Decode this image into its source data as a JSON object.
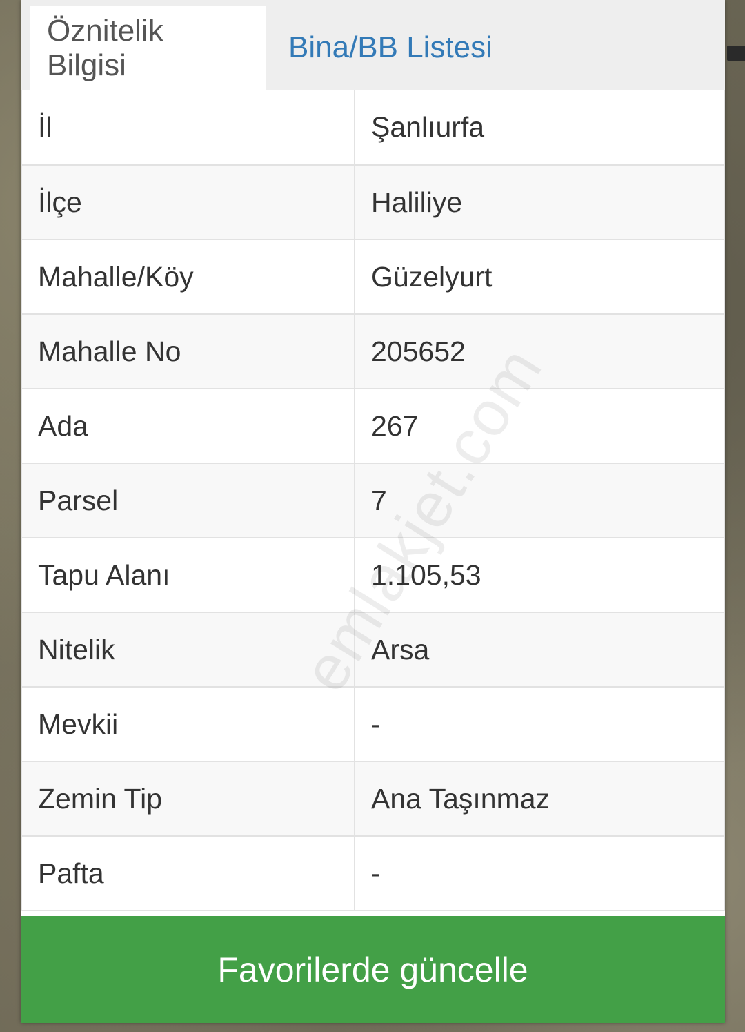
{
  "tabs": [
    {
      "label": "Öznitelik Bilgisi",
      "active": true
    },
    {
      "label": "Bina/BB Listesi",
      "active": false
    }
  ],
  "attributes": [
    {
      "label": "İl",
      "value": "Şanlıurfa"
    },
    {
      "label": "İlçe",
      "value": "Haliliye"
    },
    {
      "label": "Mahalle/Köy",
      "value": "Güzelyurt"
    },
    {
      "label": "Mahalle No",
      "value": "205652"
    },
    {
      "label": "Ada",
      "value": "267"
    },
    {
      "label": "Parsel",
      "value": "7"
    },
    {
      "label": "Tapu Alanı",
      "value": "1.105,53"
    },
    {
      "label": "Nitelik",
      "value": "Arsa"
    },
    {
      "label": "Mevkii",
      "value": "-"
    },
    {
      "label": "Zemin Tip",
      "value": "Ana Taşınmaz"
    },
    {
      "label": "Pafta",
      "value": "-"
    }
  ],
  "action": {
    "label": "Favorilerde güncelle"
  },
  "watermark": "emlakjet.com",
  "colors": {
    "tab_link": "#337ab7",
    "action_bg": "#43a047",
    "text": "#333333"
  }
}
